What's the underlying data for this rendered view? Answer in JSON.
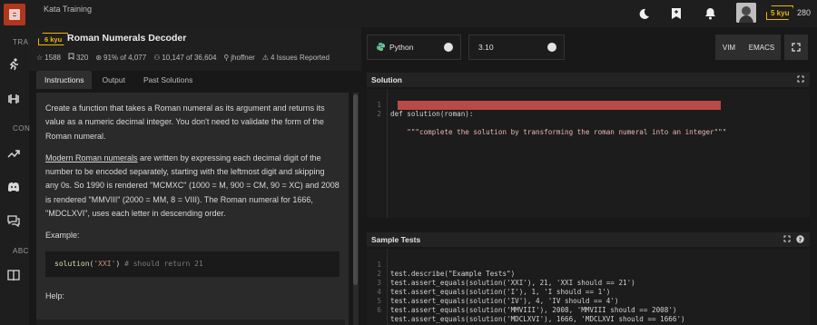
{
  "app": {
    "breadcrumb": "Kata Training",
    "honor": "280",
    "user_rank": "5 kyu",
    "accent": "#ecb613",
    "brand": "#b1361e"
  },
  "rail": {
    "labels": [
      "TRA",
      "CON",
      "ABC"
    ],
    "icons": [
      "codewars-logo-icon",
      "running-icon",
      "dumbbell-icon",
      "trending-icon",
      "discord-icon",
      "chat-icon",
      "book-icon"
    ]
  },
  "top_icons": [
    "moon-icon",
    "bookmark-icon",
    "bell-icon"
  ],
  "kata": {
    "rank": "6 kyu",
    "title": "Roman Numerals Decoder",
    "stats": {
      "stars": "1588",
      "collections": "320",
      "satisfaction": "91% of 4,077",
      "completed": "10,147 of 36,604",
      "author": "jhoffner",
      "issues": "4 Issues Reported"
    }
  },
  "tabs": [
    "Instructions",
    "Output",
    "Past Solutions"
  ],
  "instructions": {
    "p1": "Create a function that takes a Roman numeral as its argument and returns its value as a numeric decimal integer. You don't need to validate the form of the Roman numeral.",
    "p2_link": "Modern Roman numerals",
    "p2_rest": " are written by expressing each decimal digit of the number to be encoded separately, starting with the leftmost digit and skipping any 0s. So 1990 is rendered \"MCMXC\" (1000 = M, 900 = CM, 90 = XC) and 2008 is rendered \"MMVIII\" (2000 = MM, 8 = VIII). The Roman numeral for 1666, \"MDCLXVI\", uses each letter in descending order.",
    "example_label": "Example:",
    "example_fn": "solution",
    "example_arg": "'XXI'",
    "example_comment": "# should return 21",
    "help_label": "Help:"
  },
  "editor": {
    "language": "Python",
    "version": "3.10",
    "modes": [
      "VIM",
      "EMACS"
    ],
    "solution_title": "Solution",
    "solution_lines": [
      "def solution(roman):",
      "    \"\"\"complete the solution by transforming the roman numeral into an integer\"\"\""
    ],
    "tests_title": "Sample Tests",
    "test_lines": [
      "test.describe(\"Example Tests\")",
      "test.assert_equals(solution('XXI'), 21, 'XXI should == 21')",
      "test.assert_equals(solution('I'), 1, 'I should == 1')",
      "test.assert_equals(solution('IV'), 4, 'IV should == 4')",
      "test.assert_equals(solution('MMVIII'), 2008, 'MMVIII should == 2008')",
      "test.assert_equals(solution('MDCLXVI'), 1666, 'MDCLXVI should == 1666')"
    ]
  }
}
